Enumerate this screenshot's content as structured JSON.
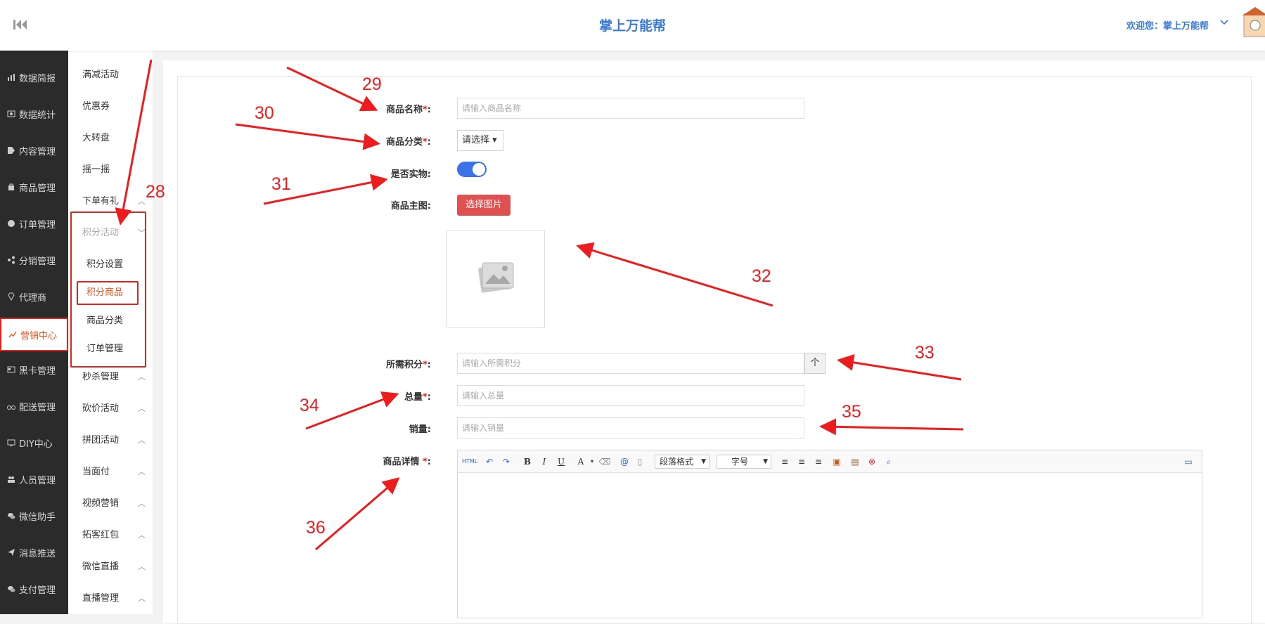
{
  "header": {
    "title": "掌上万能帮",
    "welcome": "欢迎您：掌上万能帮"
  },
  "sidebar_main": {
    "items": [
      {
        "label": "数据简报",
        "icon": "bar-chart-icon"
      },
      {
        "label": "数据统计",
        "icon": "stats-icon"
      },
      {
        "label": "内容管理",
        "icon": "tag-icon"
      },
      {
        "label": "商品管理",
        "icon": "bag-icon"
      },
      {
        "label": "订单管理",
        "icon": "order-icon"
      },
      {
        "label": "分销管理",
        "icon": "share-icon"
      },
      {
        "label": "代理商",
        "icon": "diamond-icon"
      },
      {
        "label": "营销中心",
        "icon": "line-chart-icon"
      },
      {
        "label": "黑卡管理",
        "icon": "card-icon"
      },
      {
        "label": "配送管理",
        "icon": "bike-icon"
      },
      {
        "label": "DIY中心",
        "icon": "monitor-icon"
      },
      {
        "label": "人员管理",
        "icon": "users-icon"
      },
      {
        "label": "微信助手",
        "icon": "wechat-icon"
      },
      {
        "label": "消息推送",
        "icon": "send-icon"
      },
      {
        "label": "支付管理",
        "icon": "pay-icon"
      }
    ]
  },
  "sidebar_sub": {
    "items": [
      "满减活动",
      "优惠券",
      "大转盘",
      "摇一摇",
      "下单有礼",
      "积分活动"
    ],
    "points_children": [
      "积分设置",
      "积分商品",
      "商品分类",
      "订单管理"
    ],
    "more_items": [
      "秒杀管理",
      "砍价活动",
      "拼团活动",
      "当面付",
      "视频营销",
      "拓客红包",
      "微信直播",
      "直播管理"
    ]
  },
  "form": {
    "name_label": "商品名称",
    "name_placeholder": "请输入商品名称",
    "category_label": "商品分类",
    "category_value": "请选择",
    "physical_label": "是否实物",
    "main_image_label": "商品主图",
    "choose_image_button": "选择图片",
    "points_label": "所需积分",
    "points_placeholder": "请输入所需积分",
    "stepper_symbol": "个",
    "total_label": "总量",
    "total_placeholder": "请输入总量",
    "sales_label": "销量",
    "sales_placeholder": "请输入销量",
    "detail_label": "商品详情",
    "required_mark": "*",
    "colon": ":"
  },
  "editor": {
    "html_btn": "HTML",
    "bold": "B",
    "italic": "I",
    "underline": "U",
    "font_color": "A",
    "format_label": "段落格式",
    "size_label": "字号"
  },
  "annotations": [
    "28",
    "29",
    "30",
    "31",
    "32",
    "33",
    "34",
    "35",
    "36"
  ],
  "colors": {
    "accent": "#3a7bd5",
    "danger": "#e05050",
    "annotation": "#ee1c1c",
    "toggle": "#3a73e8"
  }
}
